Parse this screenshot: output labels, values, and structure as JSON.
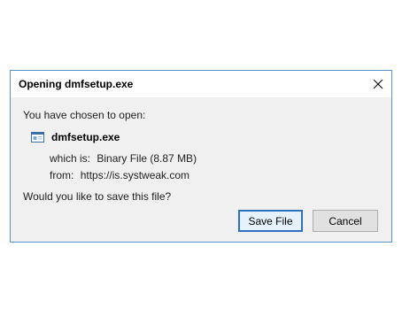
{
  "dialog": {
    "title": "Opening dmfsetup.exe",
    "prompt": "You have chosen to open:",
    "file_name": "dmfsetup.exe",
    "file_icon": "exe-window-icon",
    "which_is_label": "which is:",
    "which_is_value": "Binary File (8.87 MB)",
    "from_label": "from:",
    "from_value": "https://is.systweak.com",
    "question": "Would you like to save this file?",
    "save_label": "Save File",
    "cancel_label": "Cancel"
  },
  "colors": {
    "border": "#5a92c8",
    "default_button_border": "#2f6fc0",
    "background": "#f0f0f0"
  }
}
